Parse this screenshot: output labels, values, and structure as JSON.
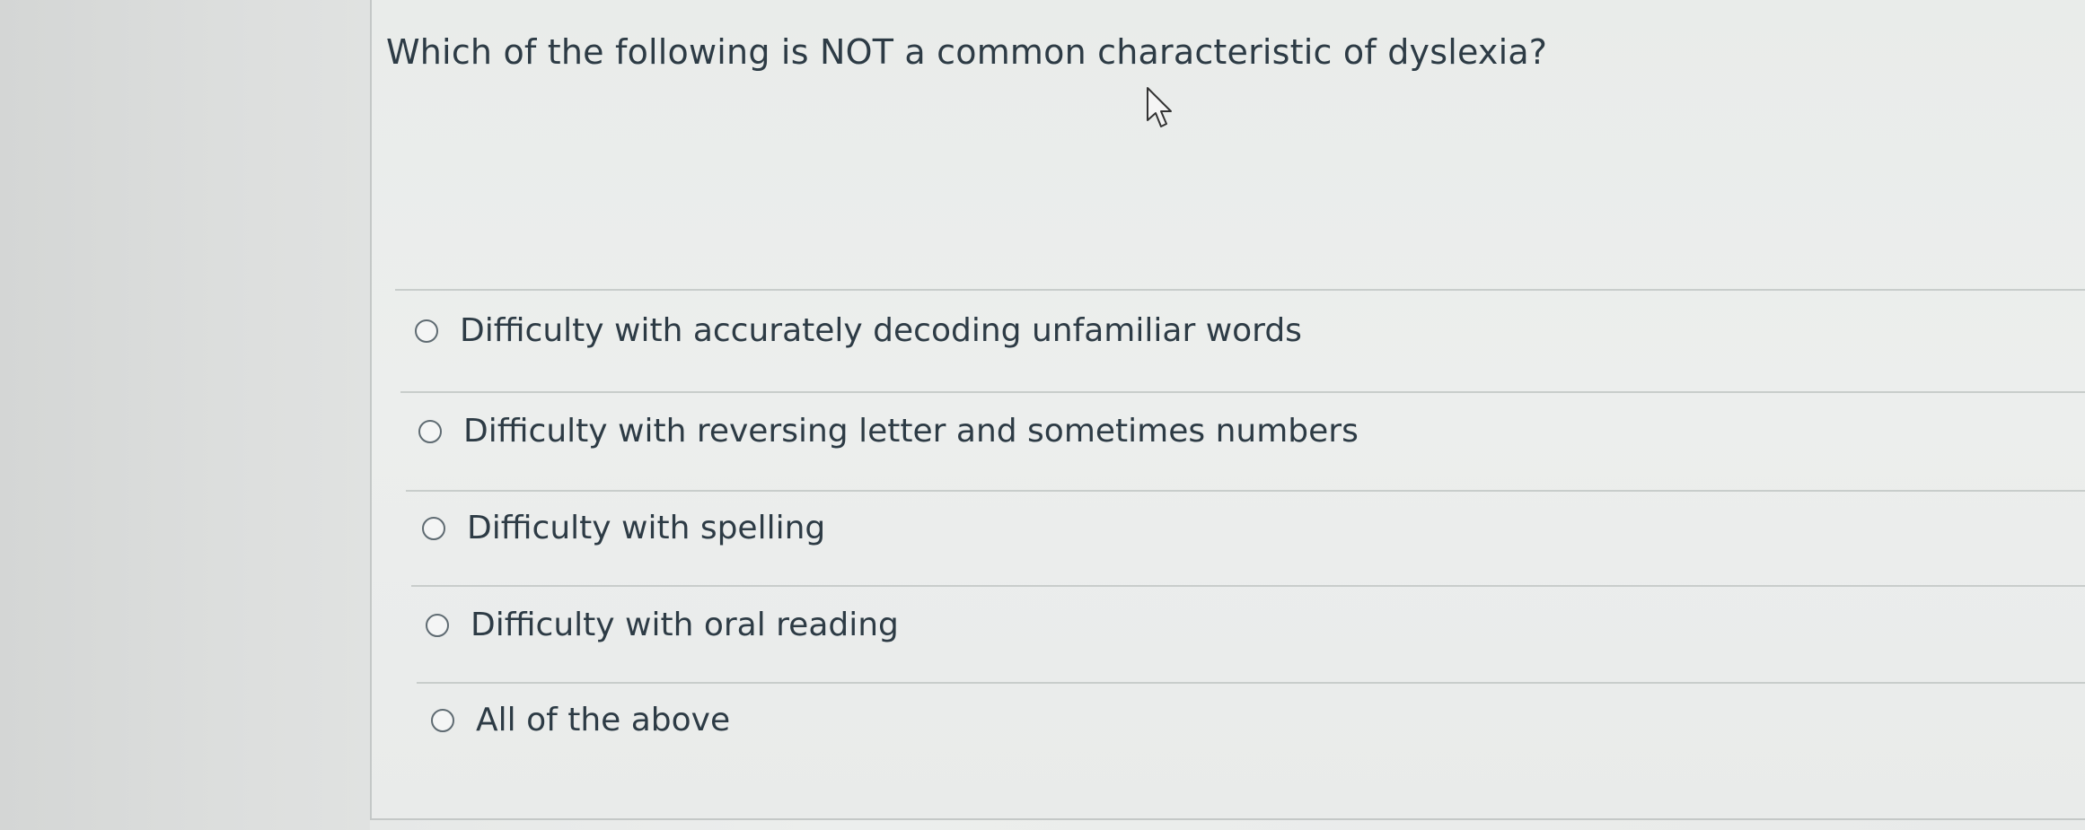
{
  "question": {
    "text": "Which of the following is NOT a common characteristic of dyslexia?"
  },
  "answers": [
    {
      "label": "Difficulty with accurately decoding unfamiliar words",
      "selected": false
    },
    {
      "label": "Difficulty with reversing letter and sometimes numbers",
      "selected": false
    },
    {
      "label": "Difficulty with spelling",
      "selected": false
    },
    {
      "label": "Difficulty with oral reading",
      "selected": false
    },
    {
      "label": "All of the above",
      "selected": false
    }
  ],
  "colors": {
    "text": "#2d3b45",
    "divider": "#c8cdcb",
    "radio_border": "#5f6b72"
  },
  "icons": {
    "cursor": "mouse-pointer-icon",
    "radio": "radio-button-unselected"
  }
}
